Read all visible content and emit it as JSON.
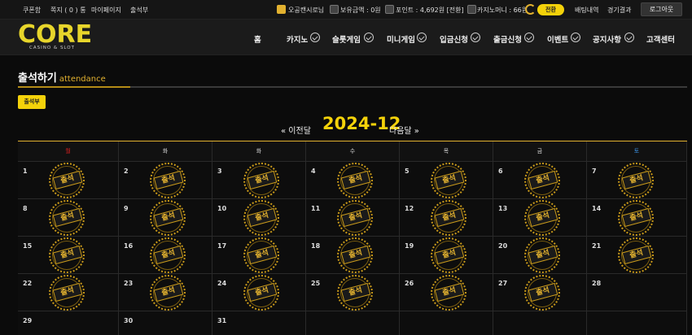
{
  "topbar": {
    "links": [
      "쿠폰함",
      "쪽지 ( 0 ) 통",
      "마이페이지",
      "출석부"
    ],
    "user": "오공캔시로님",
    "balance_label": "보유금액 : 0원",
    "point_label": "포인트 : 4,692원 [전환]",
    "casino_money": "카지노머니 : 66원",
    "convert_btn": "전환",
    "bet_history": "배팅내역",
    "results": "경기결과",
    "logout": "로그아웃"
  },
  "logo": {
    "main": "CORE",
    "sub": "CASINO & SLOT"
  },
  "nav": [
    "홈",
    "카지노",
    "슬롯게임",
    "미니게임",
    "입금신청",
    "출금신청",
    "이벤트",
    "공지사항",
    "고객센터"
  ],
  "page": {
    "title": "출석하기",
    "subtitle": "attendance",
    "attendance_btn": "출석부"
  },
  "calendar": {
    "prev": "« 이전달",
    "month": "2024-12",
    "next": "다음달 »",
    "weekdays": [
      "월",
      "화",
      "화",
      "수",
      "목",
      "금",
      "토"
    ],
    "weekday_colors": [
      "#e02020",
      "#dddddd",
      "#dddddd",
      "#dddddd",
      "#dddddd",
      "#dddddd",
      "#3a8fe0"
    ],
    "stamp_label": "출석",
    "weeks": [
      [
        {
          "day": "1",
          "stamp": true
        },
        {
          "day": "2",
          "stamp": true
        },
        {
          "day": "3",
          "stamp": true
        },
        {
          "day": "4",
          "stamp": true
        },
        {
          "day": "5",
          "stamp": true
        },
        {
          "day": "6",
          "stamp": true
        },
        {
          "day": "7",
          "stamp": true
        }
      ],
      [
        {
          "day": "8",
          "stamp": true
        },
        {
          "day": "9",
          "stamp": true
        },
        {
          "day": "10",
          "stamp": true
        },
        {
          "day": "11",
          "stamp": true
        },
        {
          "day": "12",
          "stamp": true
        },
        {
          "day": "13",
          "stamp": true
        },
        {
          "day": "14",
          "stamp": true
        }
      ],
      [
        {
          "day": "15",
          "stamp": true
        },
        {
          "day": "16",
          "stamp": true
        },
        {
          "day": "17",
          "stamp": true
        },
        {
          "day": "18",
          "stamp": true
        },
        {
          "day": "19",
          "stamp": true
        },
        {
          "day": "20",
          "stamp": true
        },
        {
          "day": "21",
          "stamp": true
        }
      ],
      [
        {
          "day": "22",
          "stamp": true
        },
        {
          "day": "23",
          "stamp": true
        },
        {
          "day": "24",
          "stamp": true
        },
        {
          "day": "25",
          "stamp": true
        },
        {
          "day": "26",
          "stamp": true
        },
        {
          "day": "27",
          "stamp": true
        },
        {
          "day": "28",
          "stamp": false
        }
      ],
      [
        {
          "day": "29",
          "stamp": false
        },
        {
          "day": "30",
          "stamp": false
        },
        {
          "day": "31",
          "stamp": false
        },
        {
          "day": "",
          "stamp": false
        },
        {
          "day": "",
          "stamp": false
        },
        {
          "day": "",
          "stamp": false
        },
        {
          "day": "",
          "stamp": false
        }
      ]
    ]
  }
}
